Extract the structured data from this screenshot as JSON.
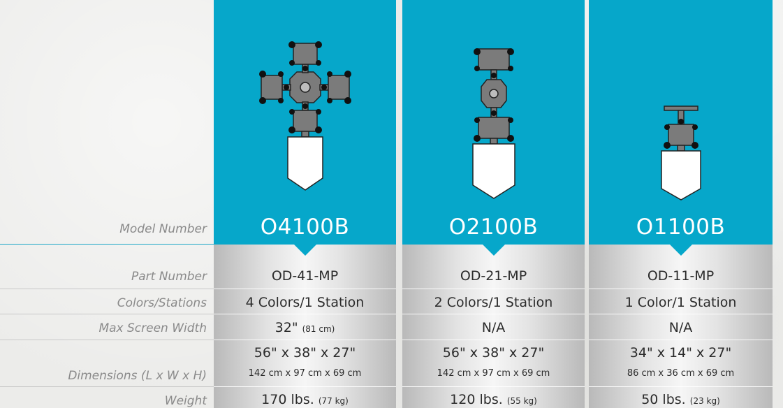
{
  "labels": {
    "model_number": "Model Number",
    "part_number": "Part Number",
    "colors_stations": "Colors/Stations",
    "max_screen_width": "Max Screen Width",
    "dimensions": "Dimensions (L x W x H)",
    "weight": "Weight"
  },
  "colors": {
    "accent": "#06a7ca",
    "label_text": "#8a8a8a",
    "value_text": "#2b2b2b"
  },
  "products": [
    {
      "model": "O4100B",
      "part": "OD-41-MP",
      "colors_stations": "4 Colors/1 Station",
      "width_main": "32\"",
      "width_sub": "(81 cm)",
      "dim_main": "56\" x 38\" x 27\"",
      "dim_sub": "142 cm x 97 cm x 69 cm",
      "weight_main": "170 lbs.",
      "weight_sub": "(77 kg)",
      "icon": "four-color-press-icon"
    },
    {
      "model": "O2100B",
      "part": "OD-21-MP",
      "colors_stations": "2 Colors/1 Station",
      "width_main": "N/A",
      "width_sub": "",
      "dim_main": "56\" x 38\" x 27\"",
      "dim_sub": "142 cm x 97 cm x 69 cm",
      "weight_main": "120 lbs.",
      "weight_sub": "(55 kg)",
      "icon": "two-color-press-icon"
    },
    {
      "model": "O1100B",
      "part": "OD-11-MP",
      "colors_stations": "1 Color/1 Station",
      "width_main": "N/A",
      "width_sub": "",
      "dim_main": "34\" x 14\" x 27\"",
      "dim_sub": "86 cm x 36 cm x 69 cm",
      "weight_main": "50 lbs.",
      "weight_sub": "(23 kg)",
      "icon": "one-color-press-icon"
    }
  ]
}
